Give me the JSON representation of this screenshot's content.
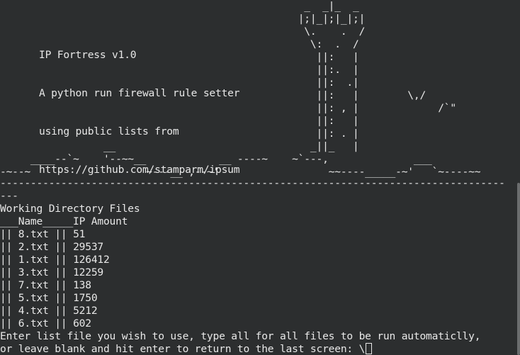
{
  "app_info": {
    "lines": [
      "IP Fortress v1.0",
      "A python run firewall rule setter",
      "using public lists from",
      "https://github.com/stamparm/ipsum"
    ]
  },
  "ascii_art": "                                                  _  _|_  _\n                                                 |;|_|;|_|;|\n                                                  \\.    .  /\n                                                   \\:  .  /\n                                                    ||:   |\n                                                    ||:.  |\n                                                    ||:  .|\n                                                    ||:   |        \\,/\n                                                    ||: , |             /`\"\n                                                    ||:   |\n                                                    ||: . |\n                 __                                _||_   |\n     ____--`~    '--~~__            __ ----~    ~`---,              ___\n-~--~                   ~---__ ,--~'                  ~~----_____-~'   `~----~~",
  "separator_top": "-----------------------------------------------------------------------------------",
  "separator_tail": "---",
  "section_title": "Working Directory Files",
  "table_header": "___Name_____IP Amount",
  "files": [
    {
      "name": "8.txt",
      "ip_amount": "51"
    },
    {
      "name": "2.txt",
      "ip_amount": "29537"
    },
    {
      "name": "1.txt",
      "ip_amount": "126412"
    },
    {
      "name": "3.txt",
      "ip_amount": "12259"
    },
    {
      "name": "7.txt",
      "ip_amount": "138"
    },
    {
      "name": "5.txt",
      "ip_amount": "1750"
    },
    {
      "name": "4.txt",
      "ip_amount": "5212"
    },
    {
      "name": "6.txt",
      "ip_amount": "602"
    }
  ],
  "prompt": {
    "line1": "Enter list file you wish to use, type all for all files to be run automaticlly,",
    "line2": "or leave blank and hit enter to return to the last screen: \\"
  },
  "colors": {
    "background": "#2c2e2f",
    "text": "#e8e8e8"
  }
}
